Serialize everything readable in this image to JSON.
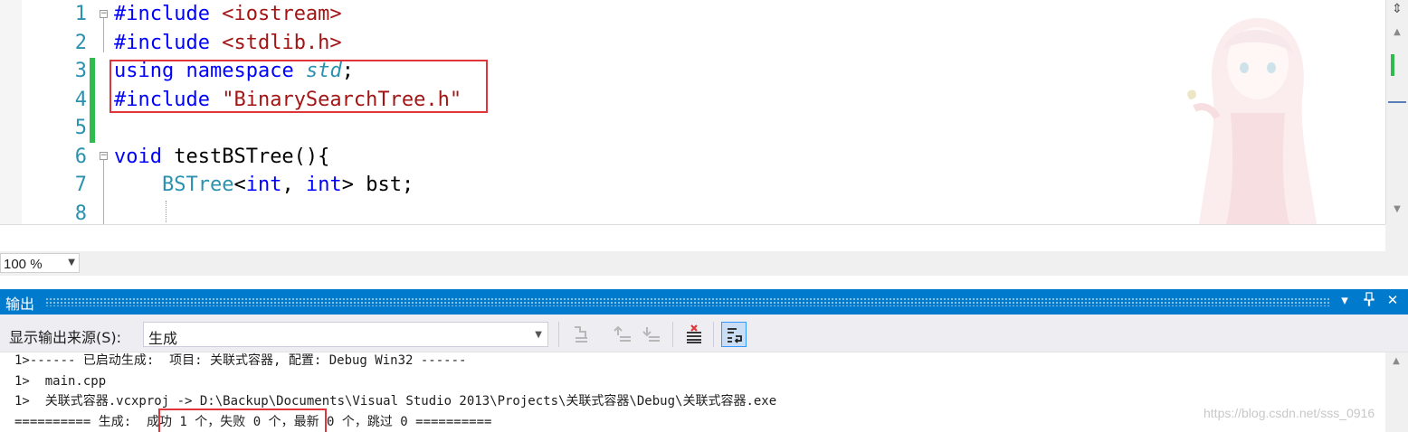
{
  "editor": {
    "line_numbers": [
      "1",
      "2",
      "3",
      "4",
      "5",
      "6",
      "7",
      "8"
    ],
    "lines": [
      [
        {
          "t": "#include",
          "c": "kw"
        },
        {
          "t": " ",
          "c": "plain"
        },
        {
          "t": "<iostream>",
          "c": "str"
        }
      ],
      [
        {
          "t": "#include",
          "c": "kw"
        },
        {
          "t": " ",
          "c": "plain"
        },
        {
          "t": "<stdlib.h>",
          "c": "str"
        }
      ],
      [
        {
          "t": "using",
          "c": "kw"
        },
        {
          "t": " ",
          "c": "plain"
        },
        {
          "t": "namespace",
          "c": "kw"
        },
        {
          "t": " ",
          "c": "plain"
        },
        {
          "t": "std",
          "c": "ns"
        },
        {
          "t": ";",
          "c": "plain"
        }
      ],
      [
        {
          "t": "#include",
          "c": "kw"
        },
        {
          "t": " ",
          "c": "plain"
        },
        {
          "t": "\"BinarySearchTree.h\"",
          "c": "str"
        }
      ],
      [],
      [
        {
          "t": "void",
          "c": "kw"
        },
        {
          "t": " testBSTree(){",
          "c": "plain"
        }
      ],
      [
        {
          "t": "    ",
          "c": "plain"
        },
        {
          "t": "BSTree",
          "c": "type"
        },
        {
          "t": "<",
          "c": "plain"
        },
        {
          "t": "int",
          "c": "kw"
        },
        {
          "t": ", ",
          "c": "plain"
        },
        {
          "t": "int",
          "c": "kw"
        },
        {
          "t": "> bst;",
          "c": "plain"
        }
      ],
      []
    ],
    "split_glyph": "⇕",
    "zoom_level": "100 %"
  },
  "output": {
    "title": "输出",
    "source_label": "显示输出来源(S):",
    "source_value": "生成",
    "lines": [
      "1>------ 已启动生成:  项目: 关联式容器, 配置: Debug Win32 ------",
      "1>  main.cpp",
      "1>  关联式容器.vcxproj -> D:\\Backup\\Documents\\Visual Studio 2013\\Projects\\关联式容器\\Debug\\关联式容器.exe",
      "========== 生成:  成功 1 个，失败 0 个，最新 0 个，跳过 0 =========="
    ],
    "watermark": "https://blog.csdn.net/sss_0916",
    "title_buttons": [
      "▾",
      "ꟷ",
      "✕"
    ]
  },
  "colors": {
    "accent": "#007acc",
    "highlight_box": "#e0353b",
    "change_bar": "#2ebc4f",
    "keyword": "#0000ff",
    "string": "#a31515",
    "type": "#2b91af"
  },
  "icons": [
    "outline-collapse-icon",
    "split-window-icon",
    "scroll-up-icon",
    "scroll-down-icon",
    "dropdown-arrow-icon",
    "find-message-icon",
    "prev-message-icon",
    "next-message-icon",
    "clear-all-icon",
    "word-wrap-icon",
    "dropdown-panel-icon",
    "pin-icon",
    "close-icon"
  ]
}
